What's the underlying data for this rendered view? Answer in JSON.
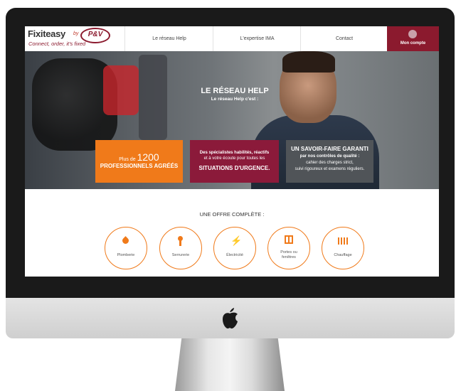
{
  "brand": {
    "name": "Fixiteasy",
    "by": "by",
    "partner": "P&V",
    "tagline": "Connect, order, it's fixed"
  },
  "nav": {
    "items": [
      "Le réseau Help",
      "L'expertise IMA",
      "Contact"
    ],
    "account": "Mon compte"
  },
  "hero": {
    "title": "LE RÉSEAU HELP",
    "subtitle": "Le réseau Help c'est :",
    "box1": {
      "prefix": "Plus de",
      "number": "1200",
      "label": "PROFESSIONNELS AGRÉÉS"
    },
    "box2": {
      "line1": "Des spécialistes habilités, réactifs",
      "line2": "et à votre écoute pour toutes les",
      "line3": "SITUATIONS D'URGENCE."
    },
    "box3": {
      "line1": "UN SAVOIR-FAIRE GARANTI",
      "line2": "par nos contrôles de qualité :",
      "line3": "cahier des charges strict,",
      "line4": "suivi rigoureux et examens réguliers."
    }
  },
  "offer": {
    "title": "UNE OFFRE COMPLÈTE :",
    "items": [
      {
        "label": "Plomberie",
        "icon": "drop-icon"
      },
      {
        "label": "Serrurerie",
        "icon": "key-icon"
      },
      {
        "label": "Électricité",
        "icon": "lightning-icon"
      },
      {
        "label": "Portes ou",
        "label2": "fenêtres",
        "icon": "door-icon"
      },
      {
        "label": "Chauffage",
        "icon": "radiator-icon"
      }
    ]
  },
  "colors": {
    "accent": "#f07a1a",
    "brand": "#8b1a2e",
    "dark": "#505458"
  }
}
